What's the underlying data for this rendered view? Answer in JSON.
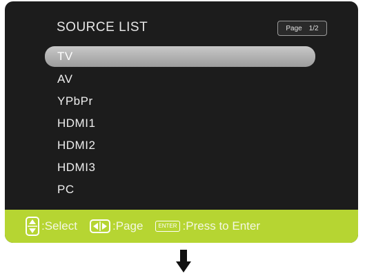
{
  "osd": {
    "title": "SOURCE LIST",
    "page_label": "Page",
    "page_value": "1/2"
  },
  "sources": [
    {
      "label": "TV",
      "selected": true
    },
    {
      "label": "AV",
      "selected": false
    },
    {
      "label": "YPbPr",
      "selected": false
    },
    {
      "label": "HDMI1",
      "selected": false
    },
    {
      "label": "HDMI2",
      "selected": false
    },
    {
      "label": "HDMI3",
      "selected": false
    },
    {
      "label": "PC",
      "selected": false
    }
  ],
  "footer": {
    "select_label": ":Select",
    "page_label": ":Page",
    "enter_key": "ENTER",
    "enter_label": ":Press to Enter"
  },
  "icons": {
    "updown": "up-down-arrows-icon",
    "leftright": "left-right-arrows-icon",
    "enter": "enter-key-icon",
    "next": "down-arrow-icon"
  },
  "colors": {
    "panel": "#1c1c1c",
    "footer": "#b6d532",
    "highlight": "#b4b4b4"
  }
}
